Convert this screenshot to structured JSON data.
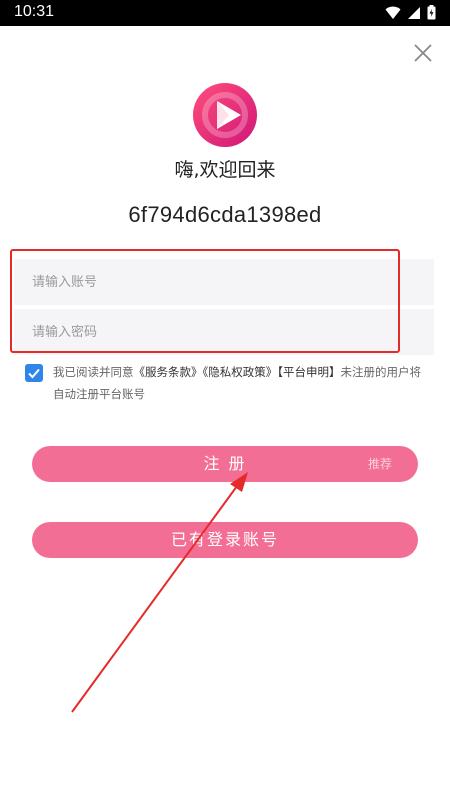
{
  "status_bar": {
    "time": "10:31"
  },
  "header": {
    "greeting": "嗨,欢迎回来",
    "device_id": "6f794d6cda1398ed"
  },
  "form": {
    "account_placeholder": "请输入账号",
    "password_placeholder": "请输入密码"
  },
  "agreement": {
    "checked": true,
    "prefix": "我已阅读并同意",
    "terms": "《服务条款》",
    "privacy": "《隐私权政策》",
    "statement": "【平台申明】",
    "suffix": "未注册的用户将自动注册平台账号"
  },
  "buttons": {
    "register_label": "注 册",
    "register_badge": "推荐",
    "login_label": "已有登录账号"
  },
  "colors": {
    "accent": "#f36e95",
    "checkbox": "#2f86e8",
    "highlight": "#e52a2a",
    "arrow": "#e52a2a"
  }
}
